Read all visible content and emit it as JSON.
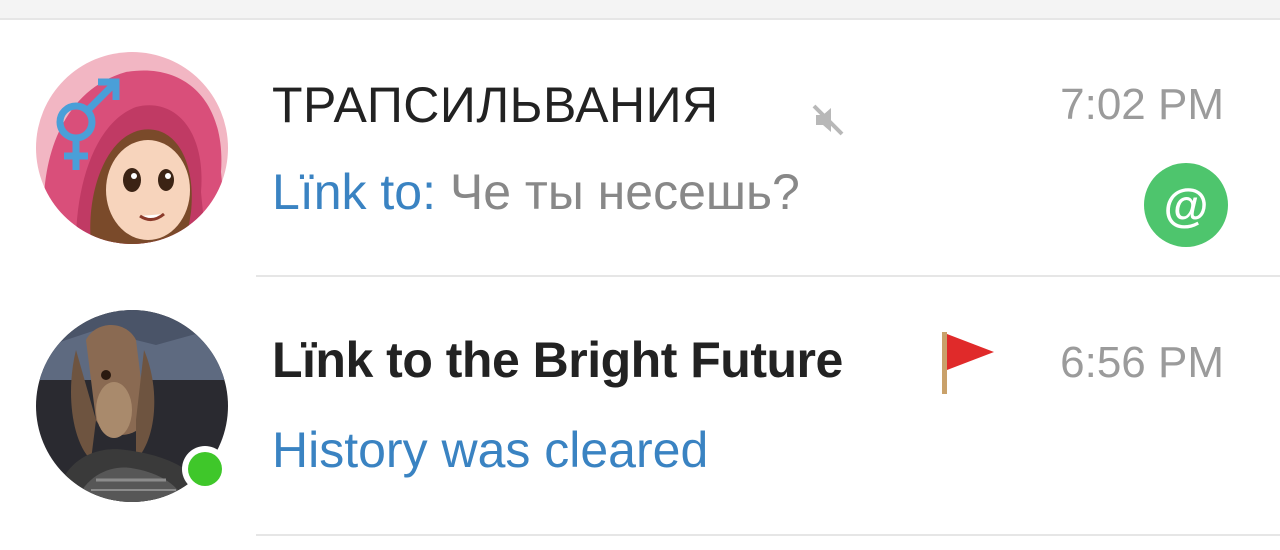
{
  "chats": [
    {
      "title": "ТРАПСИЛЬВАНИЯ",
      "time": "7:02 PM",
      "preview_sender": "Lïnk to:",
      "preview_text": " Че ты несешь?",
      "muted": true,
      "mention_badge": "@",
      "avatar_icon": "anime-girl-avatar",
      "badge_color": "#4ec56d"
    },
    {
      "title": "Lïnk to the Bright Future",
      "time": "6:56 PM",
      "preview_service": "History was cleared",
      "flag_icon": "red-flag-icon",
      "online": true,
      "avatar_icon": "jarjar-avatar",
      "online_color": "#3fc72a"
    }
  ],
  "colors": {
    "accent_blue": "#3a83c2",
    "time_gray": "#9b9b9b",
    "title_dark": "#222222"
  }
}
